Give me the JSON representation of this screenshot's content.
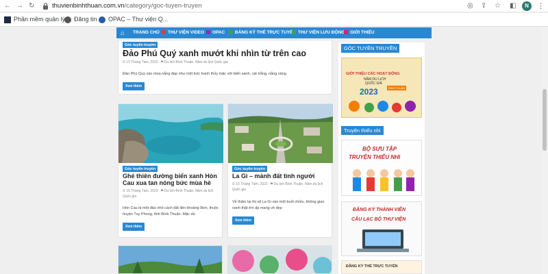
{
  "browser": {
    "url_domain": "thuvienbinhthuan.com.vn",
    "url_path": "/category/goc-tuyen-truyen",
    "avatar_letter": "N",
    "bookmarks": [
      "Phần mềm quản lý...",
      "Đăng tin",
      "OPAC – Thư viện Q..."
    ]
  },
  "nav": {
    "items": [
      "TRANG CHỦ",
      "THƯ VIỆN VIDEO",
      "OPAC",
      "ĐĂNG KÝ THẺ TRỰC TUYẾN",
      "THƯ VIỆN LƯU ĐỘNG",
      "GIỚI THIỆU"
    ]
  },
  "posts": [
    {
      "category": "Góc tuyên truyền",
      "title": "Đảo Phú Quý xanh mướt khi nhìn từ trên cao",
      "date": "15 Tháng Tám, 2023",
      "tags": "Du lịch Bình Thuận, Năm du lịch Quốc gia",
      "excerpt": "Đảo Phú Quý vào mùa nắng đẹp như một bức tranh thủy mặc với biển xanh, cát trắng, nắng vàng.",
      "button": "Xem thêm"
    },
    {
      "category": "Góc tuyên truyền",
      "title": "Ghé thiên đường biển xanh Hòn Cau xua tan nóng bức mùa hè",
      "date": "15 Tháng Tám, 2023",
      "tags": "Du lịch Bình Thuận, Năm du lịch Quốc gia",
      "excerpt": "Hòn Cau là một đảo nhỏ cách đất liền khoảng 9km, thuộc huyện Tuy Phong, tỉnh Bình Thuận. Mặc dù",
      "button": "Xem thêm"
    },
    {
      "category": "Góc tuyên truyền",
      "title": "La Gi – mảnh đất tình người",
      "date": "15 Tháng Tám, 2023",
      "tags": "Du lịch Bình Thuận, Năm du lịch Quốc gia",
      "excerpt": "Về thăm lại thị xã La Gi vào một buổi chiều, không gian xanh thật êm ấp mang vẻ đẹp",
      "button": "Xem thêm"
    }
  ],
  "sidebar": {
    "box1_title": "GÓC TUYÊN TRUYỀN",
    "poster": {
      "line1": "GIỚI THIỆU CÁC HOẠT ĐỘNG",
      "line2": "NĂM DU LỊCH",
      "line3": "QUỐC GIA",
      "year": "2023",
      "place": "BÌNH THUẬN"
    },
    "box2_title": "Truyện thiếu nhi",
    "kids_line1": "BỘ SƯU TẬP",
    "kids_line2": "TRUYỆN THIẾU NHI",
    "register_line1": "ĐĂNG KÝ THÀNH VIÊN",
    "register_line2": "CÂU LẠC BỘ THƯ VIỆN",
    "bottom_label": "ĐĂNG KÝ THẺ TRỰC TUYẾN"
  },
  "colors": {
    "accent": "#2a88d2",
    "avatar": "#2a7a6b"
  }
}
